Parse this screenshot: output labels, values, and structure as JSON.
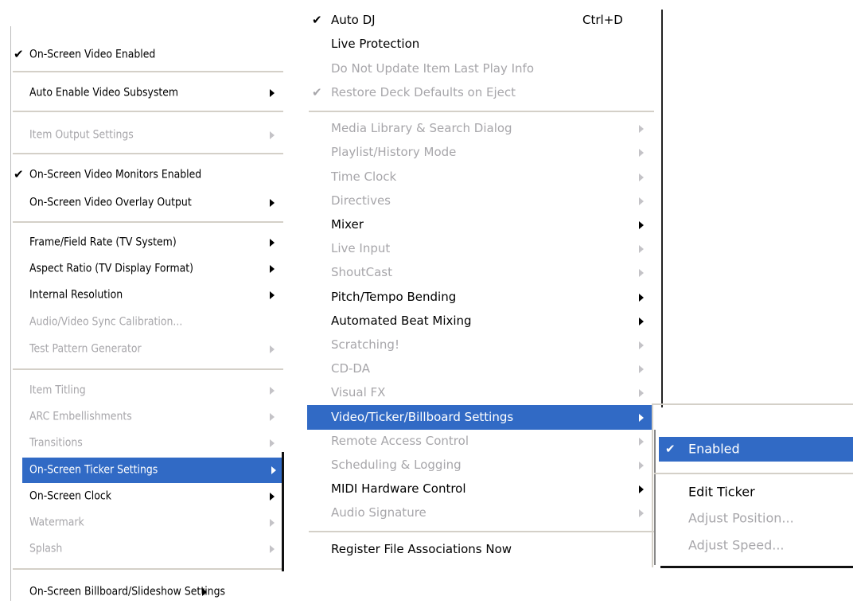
{
  "menu_left": {
    "items": [
      {
        "label": "On-Screen Video Enabled",
        "checked": true,
        "disabled": false,
        "submenu": false
      },
      {
        "label": "Auto Enable Video Subsystem",
        "checked": false,
        "disabled": false,
        "submenu": true
      },
      {
        "label": "Item Output Settings",
        "checked": false,
        "disabled": true,
        "submenu": true
      },
      {
        "label": "On-Screen Video Monitors Enabled",
        "checked": true,
        "disabled": false,
        "submenu": false
      },
      {
        "label": "On-Screen Video Overlay Output",
        "checked": false,
        "disabled": false,
        "submenu": true
      },
      {
        "label": "Frame/Field Rate (TV System)",
        "checked": false,
        "disabled": false,
        "submenu": true
      },
      {
        "label": "Aspect Ratio (TV Display Format)",
        "checked": false,
        "disabled": false,
        "submenu": true
      },
      {
        "label": "Internal Resolution",
        "checked": false,
        "disabled": false,
        "submenu": true
      },
      {
        "label": "Audio/Video Sync Calibration...",
        "checked": false,
        "disabled": true,
        "submenu": false
      },
      {
        "label": "Test Pattern Generator",
        "checked": false,
        "disabled": true,
        "submenu": true
      },
      {
        "label": "Item Titling",
        "checked": false,
        "disabled": true,
        "submenu": true
      },
      {
        "label": "ARC Embellishments",
        "checked": false,
        "disabled": true,
        "submenu": true
      },
      {
        "label": "Transitions",
        "checked": false,
        "disabled": true,
        "submenu": true
      },
      {
        "label": "On-Screen Ticker Settings",
        "checked": false,
        "disabled": false,
        "submenu": true,
        "selected": true
      },
      {
        "label": "On-Screen Clock",
        "checked": false,
        "disabled": false,
        "submenu": true
      },
      {
        "label": "Watermark",
        "checked": false,
        "disabled": true,
        "submenu": true
      },
      {
        "label": "Splash",
        "checked": false,
        "disabled": true,
        "submenu": true
      },
      {
        "label": "On-Screen Billboard/Slideshow Settings",
        "checked": false,
        "disabled": false,
        "submenu": true
      }
    ]
  },
  "menu_middle": {
    "items": [
      {
        "label": "Auto DJ",
        "shortcut": "Ctrl+D",
        "checked": true,
        "disabled": false,
        "submenu": false
      },
      {
        "label": "Live Protection",
        "checked": false,
        "disabled": false,
        "submenu": false
      },
      {
        "label": "Do Not Update Item Last Play Info",
        "checked": false,
        "disabled": true,
        "submenu": false
      },
      {
        "label": "Restore Deck Defaults on Eject",
        "checked": true,
        "disabled": true,
        "submenu": false
      },
      {
        "label": "Media Library & Search Dialog",
        "checked": false,
        "disabled": true,
        "submenu": true
      },
      {
        "label": "Playlist/History Mode",
        "checked": false,
        "disabled": true,
        "submenu": true
      },
      {
        "label": "Time Clock",
        "checked": false,
        "disabled": true,
        "submenu": true
      },
      {
        "label": "Directives",
        "checked": false,
        "disabled": true,
        "submenu": true
      },
      {
        "label": "Mixer",
        "checked": false,
        "disabled": false,
        "submenu": true
      },
      {
        "label": "Live Input",
        "checked": false,
        "disabled": true,
        "submenu": true
      },
      {
        "label": "ShoutCast",
        "checked": false,
        "disabled": true,
        "submenu": true
      },
      {
        "label": "Pitch/Tempo Bending",
        "checked": false,
        "disabled": false,
        "submenu": true
      },
      {
        "label": "Automated Beat Mixing",
        "checked": false,
        "disabled": false,
        "submenu": true
      },
      {
        "label": "Scratching!",
        "checked": false,
        "disabled": true,
        "submenu": true
      },
      {
        "label": "CD-DA",
        "checked": false,
        "disabled": true,
        "submenu": true
      },
      {
        "label": "Visual FX",
        "checked": false,
        "disabled": true,
        "submenu": true
      },
      {
        "label": "Video/Ticker/Billboard Settings",
        "checked": false,
        "disabled": false,
        "submenu": true,
        "selected": true
      },
      {
        "label": "Remote Access Control",
        "checked": false,
        "disabled": true,
        "submenu": true
      },
      {
        "label": "Scheduling & Logging",
        "checked": false,
        "disabled": true,
        "submenu": true
      },
      {
        "label": "MIDI Hardware Control",
        "checked": false,
        "disabled": false,
        "submenu": true
      },
      {
        "label": "Audio Signature",
        "checked": false,
        "disabled": true,
        "submenu": true
      },
      {
        "label": "Register File Associations Now",
        "checked": false,
        "disabled": false,
        "submenu": false
      }
    ]
  },
  "menu_right": {
    "items": [
      {
        "label": "Enabled",
        "checked": true,
        "disabled": false,
        "selected": true
      },
      {
        "label": "Edit Ticker",
        "checked": false,
        "disabled": false
      },
      {
        "label": "Adjust Position...",
        "checked": false,
        "disabled": true
      },
      {
        "label": "Adjust Speed...",
        "checked": false,
        "disabled": true
      }
    ]
  },
  "glyphs": {
    "check": "✔"
  },
  "colors": {
    "highlight": "#316ac5",
    "disabled_text": "#a7a6aa"
  }
}
